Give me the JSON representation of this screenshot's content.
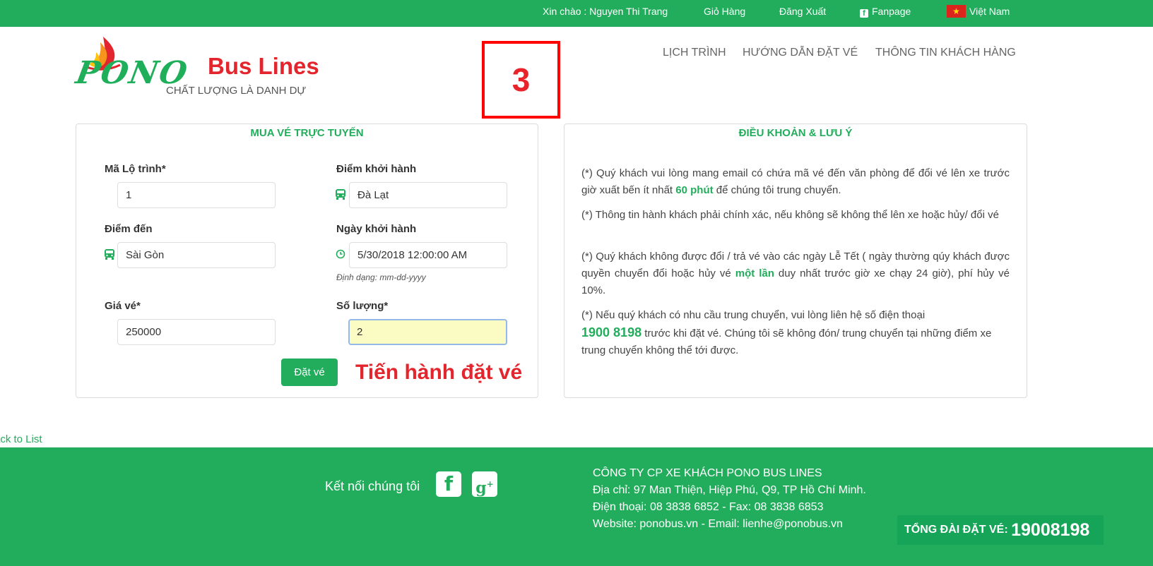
{
  "topbar": {
    "greeting": "Xin chào : Nguyen Thi Trang",
    "cart": "Giỏ Hàng",
    "logout": "Đăng Xuất",
    "fanpage": "Fanpage",
    "language": "Việt Nam"
  },
  "logo": {
    "brand": "PONO",
    "name": "Bus Lines",
    "slogan": "CHẤT LƯỢNG LÀ DANH DỰ"
  },
  "step_marker": "3",
  "nav": {
    "schedule": "LỊCH TRÌNH",
    "guide": "HƯỚNG DẪN ĐẶT VÉ",
    "customer_info": "THÔNG TIN KHÁCH HÀNG"
  },
  "booking": {
    "title": "MUA VÉ TRỰC TUYẾN",
    "route_code_label": "Mã Lộ trình*",
    "route_code_value": "1",
    "departure_label": "Điểm khởi hành",
    "departure_value": "Đà Lạt",
    "destination_label": "Điểm đến",
    "destination_value": "Sài Gòn",
    "date_label": "Ngày khởi hành",
    "date_value": "5/30/2018 12:00:00 AM",
    "date_hint": "Định dạng: mm-dd-yyyy",
    "price_label": "Giá vé*",
    "price_value": "250000",
    "quantity_label": "Số lượng*",
    "quantity_value": "2",
    "book_button": "Đặt vé",
    "annotation": "Tiến hành đặt vé"
  },
  "terms": {
    "title": "ĐIỀU KHOẢN & LƯU Ý",
    "p1_a": "(*) Quý khách vui lòng mang email có chứa mã vé đến văn phòng để đổi vé lên xe trước giờ xuất bến ít nhất ",
    "p1_hl": "60 phút",
    "p1_b": " để chúng tôi trung chuyển.",
    "p2": "(*) Thông tin hành khách phải chính xác, nếu không sẽ không thể lên xe hoặc hủy/ đổi vé",
    "p3_a": "(*) Quý khách không được đổi / trả vé vào các ngày Lễ Tết ( ngày thường qúy khách được quyền chuyển đổi hoặc hủy vé ",
    "p3_hl": "một lần",
    "p3_b": " duy nhất trước giờ xe chạy 24 giờ), phí hủy vé 10%.",
    "p4_a": "(*) Nếu quý khách có nhu cầu trung chuyển, vui lòng liên hệ số điện thoại",
    "p4_hl": "1900 8198",
    "p4_b": " trước khi đặt vé. Chúng tôi sẽ không đón/ trung chuyển tại những điểm xe trung chuyển không thể tới được."
  },
  "back_link": "ack to List",
  "footer": {
    "connect": "Kết nối chúng tôi",
    "company": "CÔNG TY CP XE KHÁCH PONO BUS LINES",
    "address": "Địa chỉ: 97 Man Thiện, Hiệp Phú, Q9, TP Hồ Chí Minh.",
    "phone": "Điện thoại: 08 3838 6852 - Fax: 08 3838 6853",
    "web": "Website: ponobus.vn - Email: lienhe@ponobus.vn",
    "hotline_label": "TỔNG ĐÀI ĐẶT VÉ: ",
    "hotline_number": "19008198"
  },
  "icons": {
    "facebook": "facebook-icon",
    "google_plus": "google-plus-icon",
    "bus": "bus-icon",
    "clock": "clock-icon",
    "flag": "vietnam-flag-icon"
  },
  "colors": {
    "brand_green": "#22ad5c",
    "brand_red": "#e3262d",
    "input_active_bg": "#fbfbc4"
  }
}
